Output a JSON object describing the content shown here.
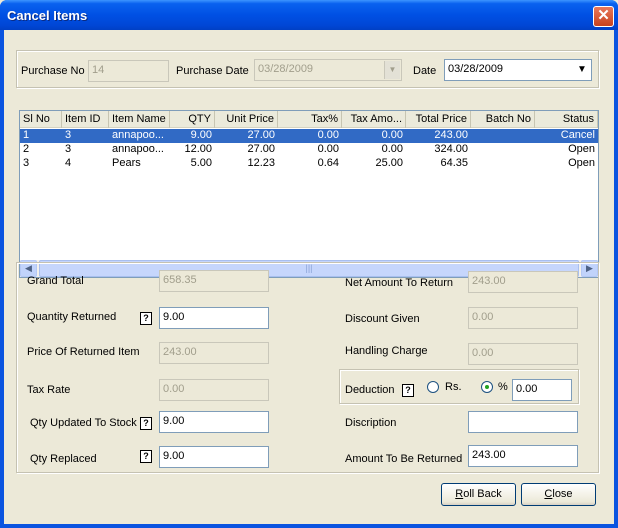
{
  "window": {
    "title": "Cancel Items"
  },
  "header": {
    "purchase_no_label": "Purchase No",
    "purchase_no_value": "14",
    "purchase_date_label": "Purchase Date",
    "purchase_date_value": "03/28/2009",
    "date_label": "Date",
    "date_value": "03/28/2009"
  },
  "table": {
    "columns": [
      "Sl No",
      "Item ID",
      "Item Name",
      "QTY",
      "Unit Price",
      "Tax%",
      "Tax Amo...",
      "Total Price",
      "Batch No",
      "Status"
    ],
    "rows": [
      {
        "sl": "1",
        "item_id": "3",
        "item_name": "annapoo...",
        "qty": "9.00",
        "unit_price": "27.00",
        "tax_pct": "0.00",
        "tax_amt": "0.00",
        "total": "243.00",
        "batch": "",
        "status": "Cancel",
        "selected": true
      },
      {
        "sl": "2",
        "item_id": "3",
        "item_name": "annapoo...",
        "qty": "12.00",
        "unit_price": "27.00",
        "tax_pct": "0.00",
        "tax_amt": "0.00",
        "total": "324.00",
        "batch": "",
        "status": "Open",
        "selected": false
      },
      {
        "sl": "3",
        "item_id": "4",
        "item_name": "Pears",
        "qty": "5.00",
        "unit_price": "12.23",
        "tax_pct": "0.64",
        "tax_amt": "25.00",
        "total": "64.35",
        "batch": "",
        "status": "Open",
        "selected": false
      }
    ]
  },
  "form": {
    "grand_total_label": "Grand Total",
    "grand_total_value": "658.35",
    "qty_returned_label": "Quantity Returned",
    "qty_returned_value": "9.00",
    "price_returned_label": "Price Of Returned Item",
    "price_returned_value": "243.00",
    "tax_rate_label": "Tax Rate",
    "tax_rate_value": "0.00",
    "qty_updated_label": "Qty Updated To Stock",
    "qty_updated_value": "9.00",
    "qty_replaced_label": "Qty Replaced",
    "qty_replaced_value": "9.00",
    "net_amount_label": "Net Amount To Return",
    "net_amount_value": "243.00",
    "discount_label": "Discount Given",
    "discount_value": "0.00",
    "handling_label": "Handling Charge",
    "handling_value": "0.00",
    "deduction_label": "Deduction",
    "deduction_rs_label": "Rs.",
    "deduction_pct_label": "%",
    "deduction_value": "0.00",
    "deduction_mode": "%",
    "description_label": "Discription",
    "description_value": "",
    "amount_returned_label": "Amount To Be Returned",
    "amount_returned_value": "243.00",
    "help_glyph": "?"
  },
  "buttons": {
    "rollback_mnemonic": "R",
    "rollback_rest": "oll Back",
    "close_mnemonic": "C",
    "close_rest": "lose"
  },
  "icons": {
    "close": "close-icon",
    "dropdown": "chevron-down-icon",
    "scroll_left": "arrow-left-icon",
    "scroll_right": "arrow-right-icon"
  },
  "colors": {
    "titlebar": "#0050e4",
    "selection": "#316ac5",
    "face": "#ece9d8"
  }
}
